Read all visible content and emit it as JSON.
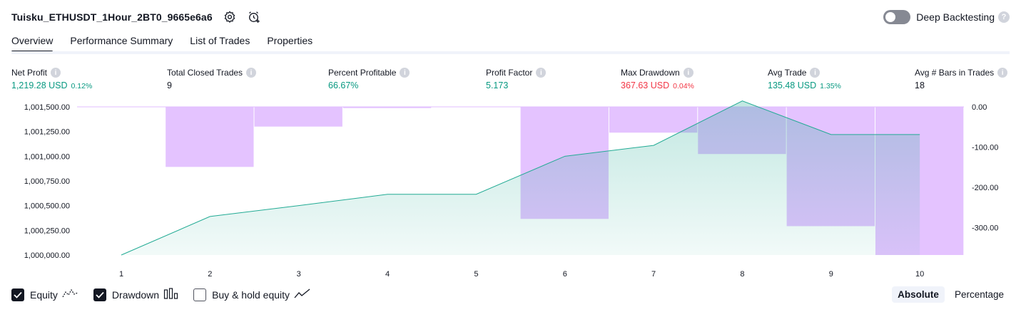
{
  "strategy": {
    "title": "Tuisku_ETHUSDT_1Hour_2BT0_9665e6a6"
  },
  "icons": {
    "settings": "gear-icon",
    "alert": "add-alert-icon",
    "help": "question-icon",
    "info": "info-icon",
    "equity": "equity-line-icon",
    "drawdown": "drawdown-bars-icon",
    "buyhold": "buy-hold-line-icon"
  },
  "deep_backtesting": {
    "label": "Deep Backtesting",
    "enabled": false,
    "help_glyph": "?"
  },
  "tabs": [
    {
      "label": "Overview",
      "active": true
    },
    {
      "label": "Performance Summary",
      "active": false
    },
    {
      "label": "List of Trades",
      "active": false
    },
    {
      "label": "Properties",
      "active": false
    }
  ],
  "stats": [
    {
      "label": "Net Profit",
      "value": "1,219.28 USD",
      "pct": "0.12%",
      "color": "#089981"
    },
    {
      "label": "Total Closed Trades",
      "value": "9",
      "pct": "",
      "color": "#131722"
    },
    {
      "label": "Percent Profitable",
      "value": "66.67%",
      "pct": "",
      "color": "#089981"
    },
    {
      "label": "Profit Factor",
      "value": "5.173",
      "pct": "",
      "color": "#089981"
    },
    {
      "label": "Max Drawdown",
      "value": "367.63 USD",
      "pct": "0.04%",
      "color": "#f23645"
    },
    {
      "label": "Avg Trade",
      "value": "135.48 USD",
      "pct": "1.35%",
      "color": "#089981"
    },
    {
      "label": "Avg # Bars in Trades",
      "value": "18",
      "pct": "",
      "color": "#131722"
    }
  ],
  "chart_data": {
    "type": "area",
    "x": [
      1,
      2,
      3,
      4,
      5,
      6,
      7,
      8,
      9,
      10
    ],
    "left_axis": {
      "ticks": [
        "1,000,000.00",
        "1,000,250.00",
        "1,000,500.00",
        "1,000,750.00",
        "1,001,000.00",
        "1,001,250.00",
        "1,001,500.00"
      ],
      "range": [
        1000000,
        1001500
      ]
    },
    "right_axis": {
      "ticks": [
        "0.00",
        "-100.00",
        "-200.00",
        "-300.00"
      ],
      "range": [
        -367.63,
        0
      ]
    },
    "series": [
      {
        "name": "Equity",
        "color": "#22ab94",
        "values": [
          1000000,
          1000390,
          1000500,
          1000615,
          1000615,
          1001000,
          1001110,
          1001560,
          1001220,
          1001220
        ]
      },
      {
        "name": "Drawdown",
        "color": "#e1bcff",
        "values": [
          0,
          -149,
          -49,
          -3,
          0,
          -278,
          -64,
          -117,
          -296,
          -367.63
        ]
      }
    ],
    "legend": [
      {
        "label": "Equity",
        "checked": true
      },
      {
        "label": "Drawdown",
        "checked": true
      },
      {
        "label": "Buy & hold equity",
        "checked": false
      }
    ]
  },
  "scale_switch": {
    "options": [
      "Absolute",
      "Percentage"
    ],
    "selected": "Absolute"
  }
}
